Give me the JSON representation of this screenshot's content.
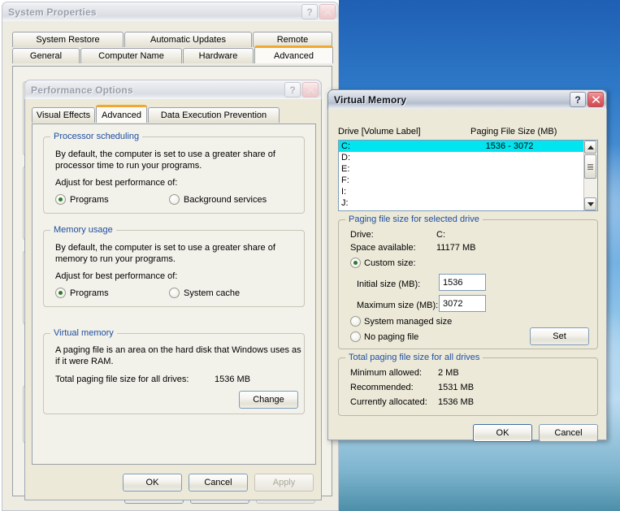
{
  "system_properties": {
    "title": "System Properties",
    "tabs_row1": [
      {
        "label": "System Restore",
        "selected": false
      },
      {
        "label": "Automatic Updates",
        "selected": false
      },
      {
        "label": "Remote",
        "selected": false
      }
    ],
    "tabs_row2": [
      {
        "label": "General",
        "selected": false
      },
      {
        "label": "Computer Name",
        "selected": false
      },
      {
        "label": "Hardware",
        "selected": false
      },
      {
        "label": "Advanced",
        "selected": true
      }
    ],
    "help_button": "?",
    "close_button": "x"
  },
  "performance_options": {
    "title": "Performance Options",
    "tabs": [
      {
        "label": "Visual Effects",
        "selected": false
      },
      {
        "label": "Advanced",
        "selected": true
      },
      {
        "label": "Data Execution Prevention",
        "selected": false
      }
    ],
    "processor_scheduling": {
      "legend": "Processor scheduling",
      "description_line1": "By default, the computer is set to use a greater share of",
      "description_line2": "processor time to run your programs.",
      "adjust_label": "Adjust for best performance of:",
      "option_programs": "Programs",
      "option_background": "Background services",
      "selected": "Programs"
    },
    "memory_usage": {
      "legend": "Memory usage",
      "description_line1": "By default, the computer is set to use a greater share of",
      "description_line2": "memory to run your programs.",
      "adjust_label": "Adjust for best performance of:",
      "option_programs": "Programs",
      "option_system_cache": "System cache",
      "selected": "Programs"
    },
    "virtual_memory": {
      "legend": "Virtual memory",
      "description_line1": "A paging file is an area on the hard disk that Windows uses as",
      "description_line2": "if it were RAM.",
      "total_label": "Total paging file size for all drives:",
      "total_value": "1536 MB",
      "change_button": "Change"
    },
    "footer": {
      "ok": "OK",
      "cancel": "Cancel",
      "apply": "Apply"
    }
  },
  "virtual_memory_dialog": {
    "title": "Virtual Memory",
    "drive_header": "Drive  [Volume Label]",
    "paging_header": "Paging File Size (MB)",
    "drives": [
      {
        "drive": "C:",
        "size": "1536 - 3072",
        "selected": true
      },
      {
        "drive": "D:",
        "size": "",
        "selected": false
      },
      {
        "drive": "E:",
        "size": "",
        "selected": false
      },
      {
        "drive": "F:",
        "size": "",
        "selected": false
      },
      {
        "drive": "I:",
        "size": "",
        "selected": false
      },
      {
        "drive": "J:",
        "size": "",
        "selected": false
      }
    ],
    "paging_group": {
      "legend": "Paging file size for selected drive",
      "drive_label": "Drive:",
      "drive_value": "C:",
      "space_label": "Space available:",
      "space_value": "11177 MB",
      "custom_size_label": "Custom size:",
      "initial_label": "Initial size (MB):",
      "initial_value": "1536",
      "maximum_label": "Maximum size (MB):",
      "maximum_value": "3072",
      "system_managed_label": "System managed size",
      "no_paging_label": "No paging file",
      "selected_option": "Custom size:",
      "set_button": "Set"
    },
    "total_group": {
      "legend": "Total paging file size for all drives",
      "minimum_label": "Minimum allowed:",
      "minimum_value": "2 MB",
      "recommended_label": "Recommended:",
      "recommended_value": "1531 MB",
      "allocated_label": "Currently allocated:",
      "allocated_value": "1536 MB"
    },
    "footer": {
      "ok": "OK",
      "cancel": "Cancel"
    },
    "help_button": "?",
    "close_button": "x"
  },
  "colors": {
    "selection": "#00e5f0",
    "legend_text": "#1f4fa0",
    "tab_accent": "#f0a830",
    "dialog_face": "#ece9d8"
  }
}
